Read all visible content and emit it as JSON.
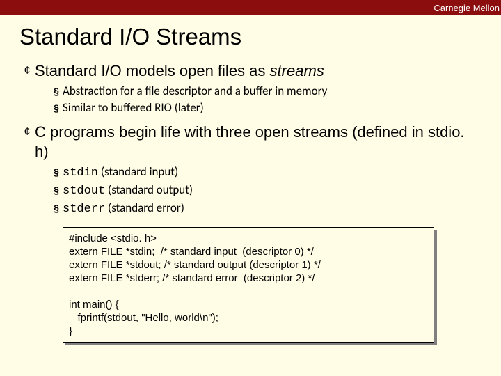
{
  "banner": {
    "text": "Carnegie Mellon"
  },
  "title": "Standard I/O Streams",
  "bullets": [
    {
      "text_pre": "Standard I/O models open files as ",
      "text_em": "streams",
      "text_post": "",
      "subs": [
        {
          "text": "Abstraction for a file descriptor and a buffer in memory"
        },
        {
          "text": "Similar to buffered RIO (later)"
        }
      ]
    },
    {
      "text_pre": "C programs begin life with three open streams (defined in stdio. h)",
      "text_em": "",
      "text_post": "",
      "subs": [
        {
          "code": "stdin",
          "rest": "  (standard input)"
        },
        {
          "code": "stdout",
          "rest": " (standard output)"
        },
        {
          "code": "stderr",
          "rest": " (standard error)"
        }
      ]
    }
  ],
  "code": {
    "l1": "#include <stdio. h>",
    "l2": "extern FILE *stdin;  /* standard input  (descriptor 0) */",
    "l3": "extern FILE *stdout; /* standard output (descriptor 1) */",
    "l4": "extern FILE *stderr; /* standard error  (descriptor 2) */",
    "l5": "",
    "l6": "int main() {",
    "l7": "   fprintf(stdout, \"Hello, world\\n\");",
    "l8": "}"
  }
}
